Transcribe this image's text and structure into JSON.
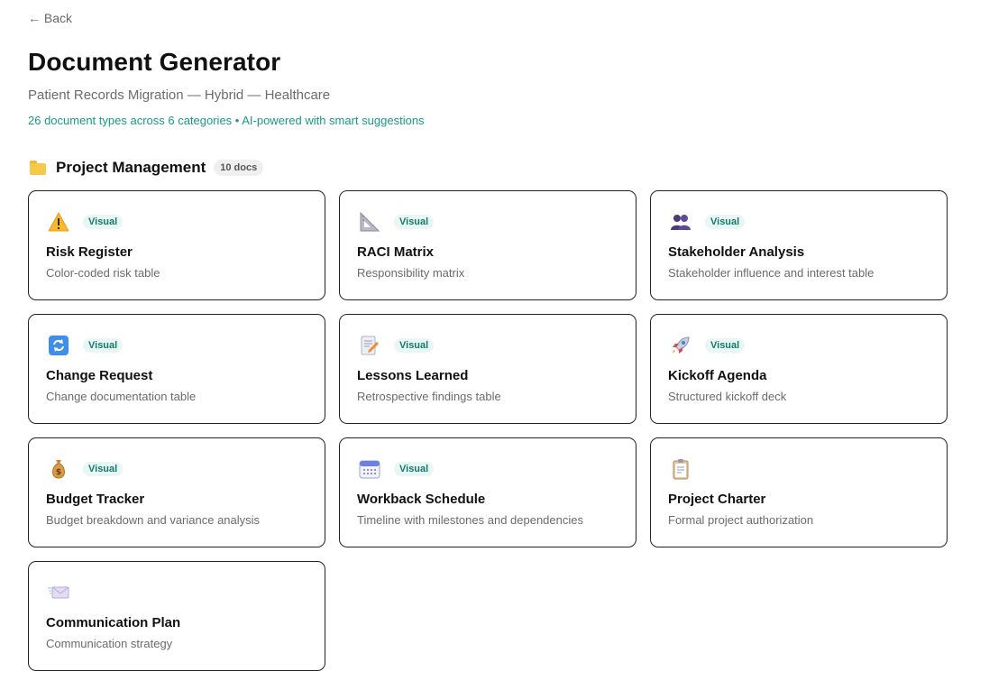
{
  "nav": {
    "back_label": "← Back"
  },
  "header": {
    "title": "Document Generator",
    "subtitle": "Patient Records Migration — Hybrid — Healthcare",
    "summary": "26 document types across 6 categories • AI-powered with smart suggestions"
  },
  "section": {
    "title": "Project Management",
    "count": "10 docs",
    "icon": "folder-icon"
  },
  "colors": {
    "accent": "#179a87",
    "badge_bg": "#e9f7f4",
    "badge_text": "#137a6b"
  },
  "cards": [
    {
      "title": "Risk Register",
      "description": "Color-coded risk table",
      "badge": "Visual",
      "icon": "warning-icon"
    },
    {
      "title": "RACI Matrix",
      "description": "Responsibility matrix",
      "badge": "Visual",
      "icon": "triangle-ruler-icon"
    },
    {
      "title": "Stakeholder Analysis",
      "description": "Stakeholder influence and interest table",
      "badge": "Visual",
      "icon": "people-icon"
    },
    {
      "title": "Change Request",
      "description": "Change documentation table",
      "badge": "Visual",
      "icon": "refresh-icon"
    },
    {
      "title": "Lessons Learned",
      "description": "Retrospective findings table",
      "badge": "Visual",
      "icon": "memo-icon"
    },
    {
      "title": "Kickoff Agenda",
      "description": "Structured kickoff deck",
      "badge": "Visual",
      "icon": "rocket-icon"
    },
    {
      "title": "Budget Tracker",
      "description": "Budget breakdown and variance analysis",
      "badge": "Visual",
      "icon": "money-bag-icon"
    },
    {
      "title": "Workback Schedule",
      "description": "Timeline with milestones and dependencies",
      "badge": "Visual",
      "icon": "calendar-icon"
    },
    {
      "title": "Project Charter",
      "description": "Formal project authorization",
      "badge": "",
      "icon": "clipboard-icon"
    },
    {
      "title": "Communication Plan",
      "description": "Communication strategy",
      "badge": "",
      "icon": "envelope-icon"
    }
  ]
}
